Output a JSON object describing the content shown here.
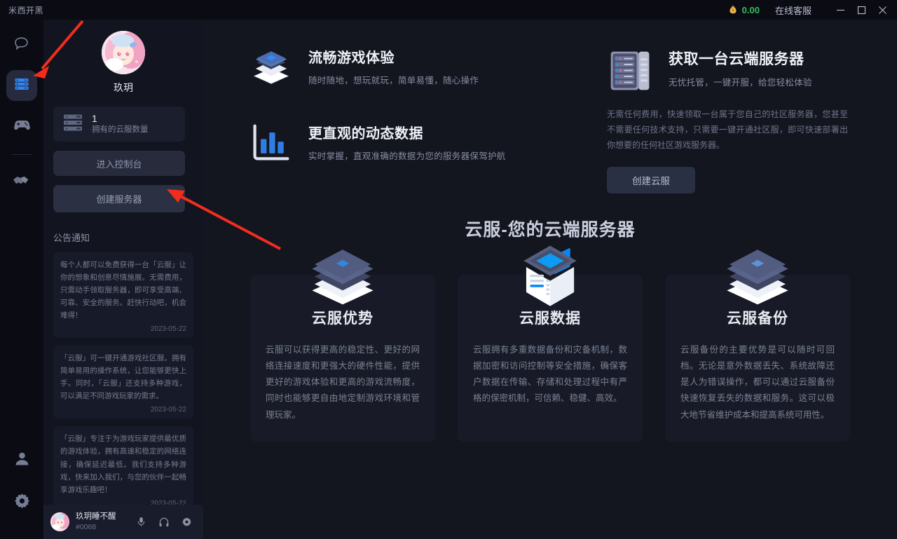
{
  "titlebar": {
    "app_title": "米西开黑",
    "coin_icon": "coin-bag-icon",
    "coin_amount": "0.00",
    "coin_color": "#2fbf5c",
    "support_label": "在线客服",
    "minimize": "minimize-icon",
    "maximize": "maximize-icon",
    "close": "close-icon"
  },
  "rail": {
    "items": [
      {
        "icon": "chat-bubble-icon",
        "active": false
      },
      {
        "icon": "server-rack-icon",
        "active": true
      },
      {
        "icon": "gamepad-icon",
        "active": false
      },
      {
        "icon": "handshake-icon",
        "active": false
      }
    ],
    "bottom": [
      {
        "icon": "user-icon"
      },
      {
        "icon": "gear-icon"
      }
    ],
    "active_color": "#2f86f6"
  },
  "left_panel": {
    "avatar": "user-avatar-anime",
    "username": "玖玥",
    "stat": {
      "icon": "server-stack-icon",
      "value": "1",
      "label": "拥有的云服数量"
    },
    "console_button": "进入控制台",
    "create_server_button": "创建服务器",
    "notice_heading": "公告通知",
    "notices": [
      {
        "text": "每个人都可以免费获得一台「云服」让你的想象和创意尽情施展。无需费用，只需动手领取服务器，即可享受高端、可靠、安全的服务。赶快行动吧，机会难得！",
        "date": "2023-05-22"
      },
      {
        "text": "「云服」可一键开通游戏社区服。拥有简单易用的操作系统，让您能够更快上手。同时，「云服」还支持多种游戏，可以满足不同游戏玩家的需求。",
        "date": "2023-05-22"
      },
      {
        "text": "「云服」专注于为游戏玩家提供最优质的游戏体验，拥有高速和稳定的网络连接，确保延迟最低。我们支持多种游戏，快来加入我们，与您的伙伴一起畅享游戏乐趣吧！",
        "date": "2023-05-22"
      }
    ]
  },
  "user_bar": {
    "avatar": "user-avatar-anime",
    "name": "玖玥睡不醒",
    "id": "#0068",
    "mic_icon": "microphone-icon",
    "headset_icon": "headphone-icon",
    "settings_icon": "gear-icon"
  },
  "main": {
    "features": [
      {
        "icon": "layers-stack-icon",
        "title": "流畅游戏体验",
        "subtitle": "随时随地，想玩就玩，简单易懂，随心操作"
      },
      {
        "icon": "bar-chart-icon",
        "title": "更直观的动态数据",
        "subtitle": "实时掌握，直观准确的数据为您的服务器保驾护航"
      }
    ],
    "promo": {
      "icon": "server-cabinet-icon",
      "title": "获取一台云端服务器",
      "subtitle": "无忧托管，一键开服，给您轻松体验",
      "description": "无需任何费用，快速领取一台属于您自己的社区服务器，您甚至不需要任何技术支持，只需要一键开通社区服，即可快速部署出你想要的任何社区游戏服务器。",
      "button": "创建云服"
    },
    "section_title": "云服-您的云端服务器",
    "cards": [
      {
        "icon": "layers-stack-icon",
        "title": "云服优势",
        "text": "云服可以获得更高的稳定性、更好的网络连接速度和更强大的硬件性能，提供更好的游戏体验和更高的游戏流畅度，同时也能够更自由地定制游戏环境和管理玩家。"
      },
      {
        "icon": "cube-data-icon",
        "title": "云服数据",
        "text": "云服拥有多重数据备份和灾备机制，数据加密和访问控制等安全措施，确保客户数据在传输、存储和处理过程中有严格的保密机制，可信赖、稳健、高效。"
      },
      {
        "icon": "layers-diamond-icon",
        "title": "云服备份",
        "text": "云服备份的主要优势是可以随时可回档。无论是意外数据丢失、系统故障还是人为错误操作，都可以通过云服备份快速恢复丢失的数据和服务。这可以极大地节省维护成本和提高系统可用性。"
      }
    ]
  },
  "annotations": {
    "arrow_color": "#f22d1e",
    "arrows": [
      {
        "name": "arrow-to-cloud-server-nav"
      },
      {
        "name": "arrow-to-create-server-button"
      }
    ]
  }
}
